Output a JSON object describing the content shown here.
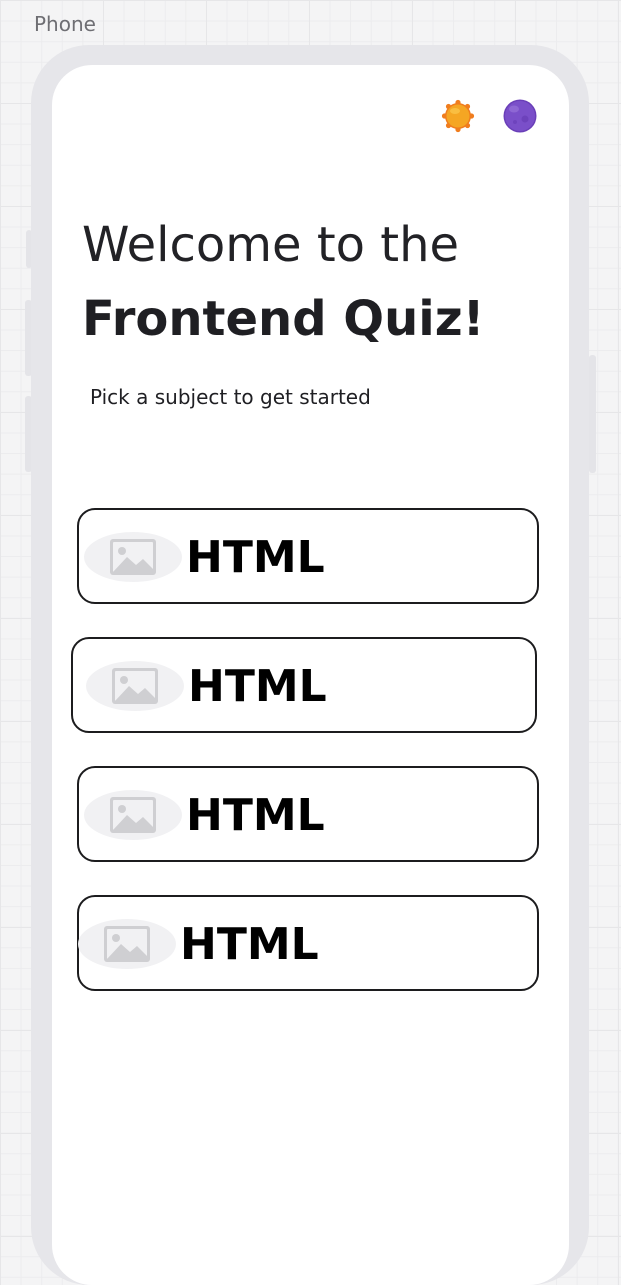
{
  "frame": {
    "label": "Phone"
  },
  "theme_toggle": {
    "light_icon": "sun-icon",
    "dark_icon": "moon-icon",
    "colors": {
      "sun": "#f5a623",
      "sun_rays": "#f07d1e",
      "moon": "#7a4fc9"
    }
  },
  "welcome": {
    "line1": "Welcome to the",
    "line2": "Frontend Quiz!",
    "subtitle": "Pick a subject to get started"
  },
  "subjects": [
    {
      "label": "HTML",
      "icon": "image-placeholder-icon"
    },
    {
      "label": "HTML",
      "icon": "image-placeholder-icon"
    },
    {
      "label": "HTML",
      "icon": "image-placeholder-icon"
    },
    {
      "label": "HTML",
      "icon": "image-placeholder-icon"
    }
  ]
}
